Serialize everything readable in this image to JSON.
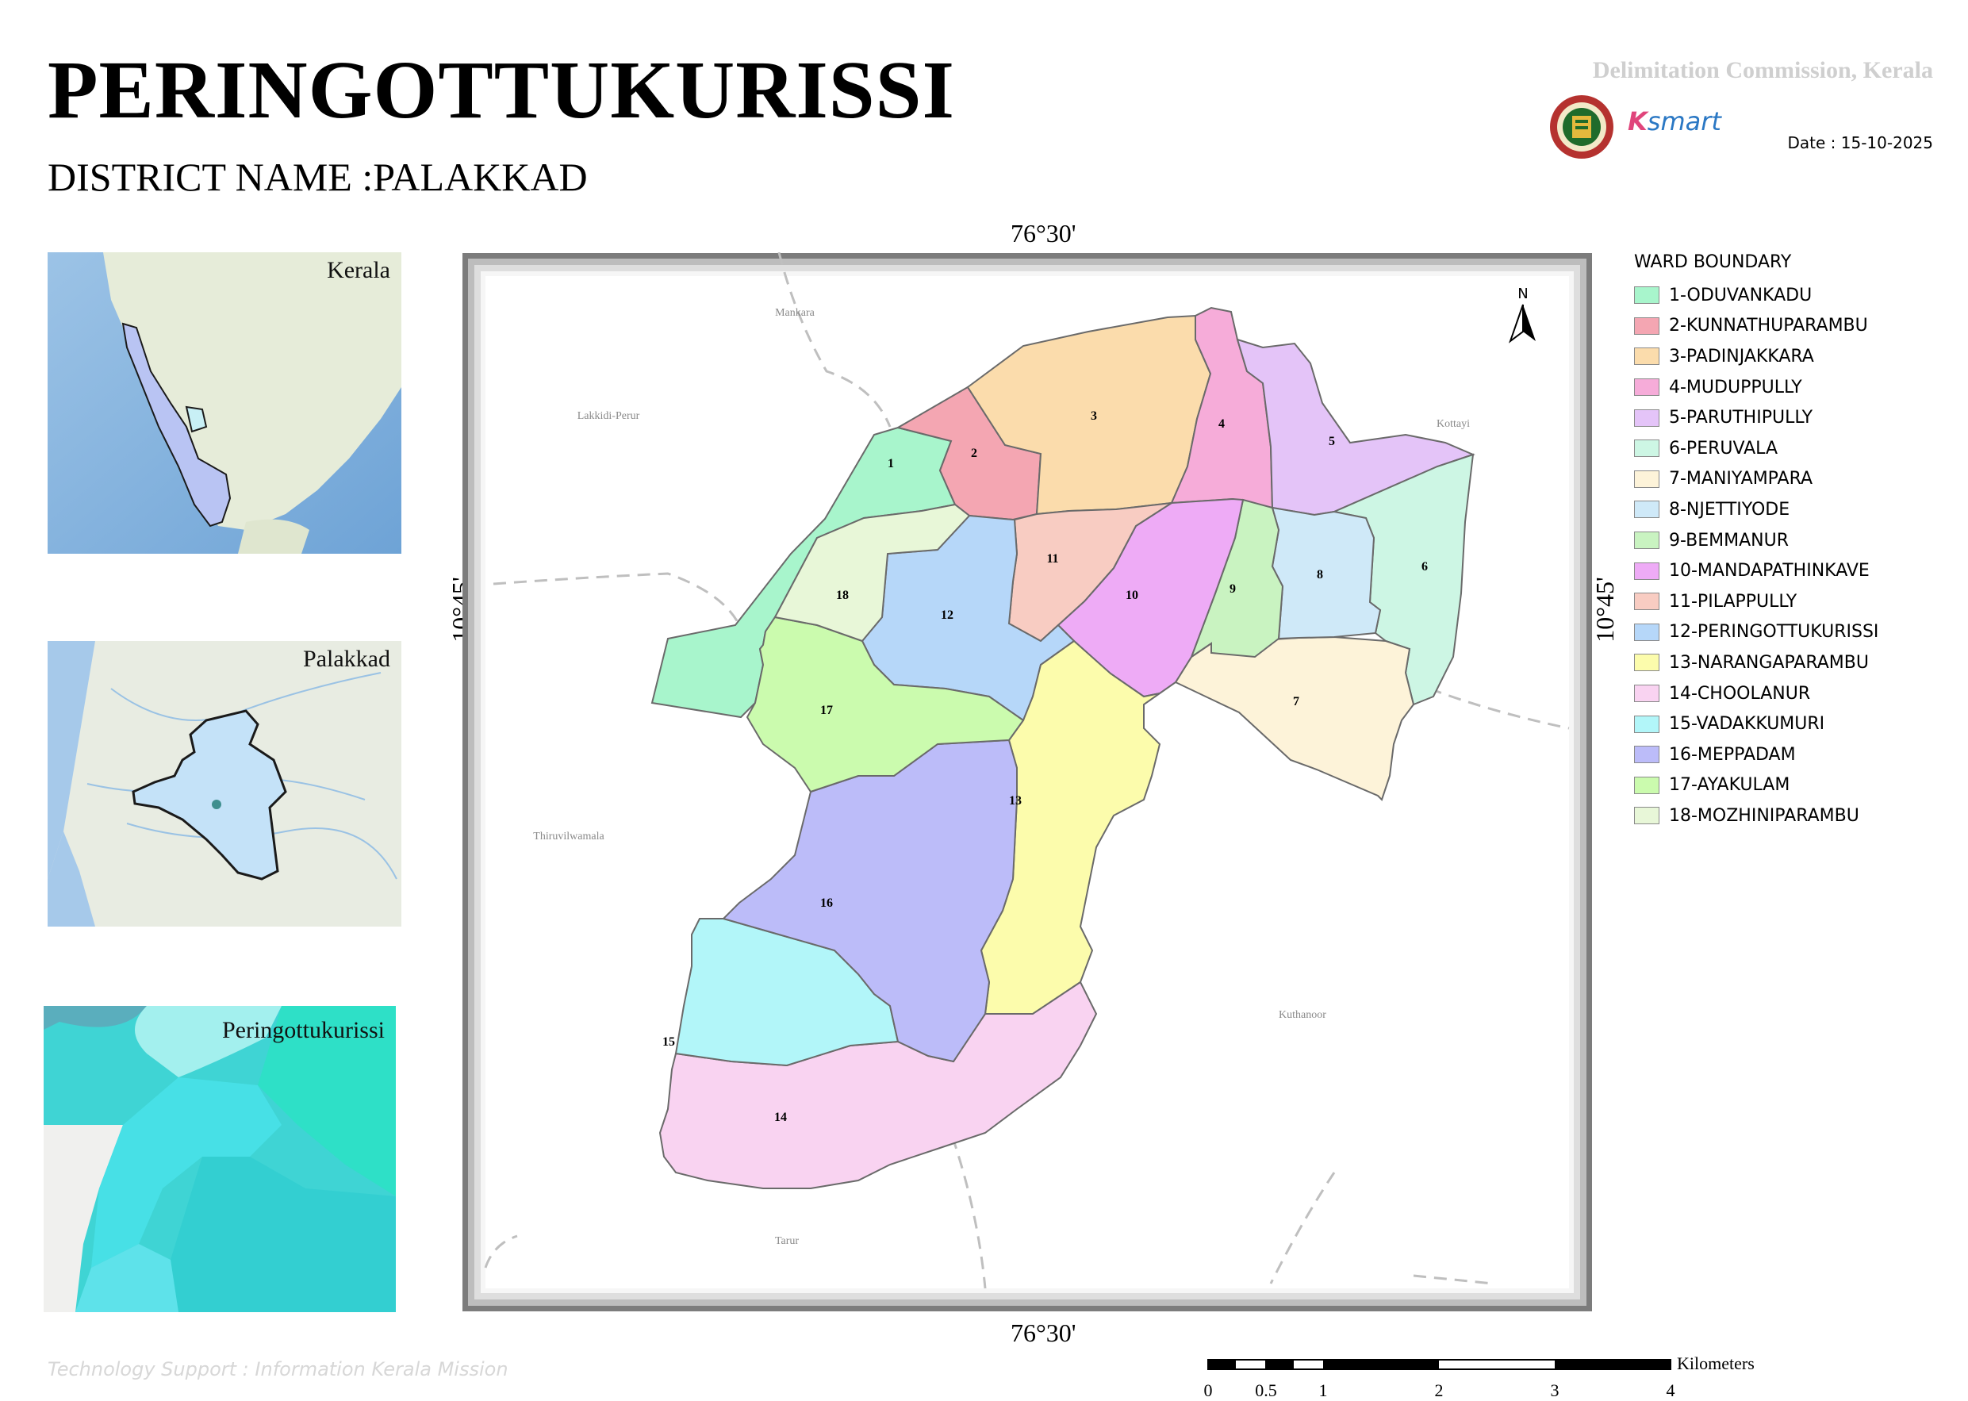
{
  "header": {
    "title": "PERINGOTTUKURISSI",
    "district": "DISTRICT NAME :PALAKKAD",
    "commission": "Delimitation Commission, Kerala",
    "date": "Date : 15-10-2025",
    "logo_text_k": "K",
    "logo_text_smart": "smart"
  },
  "insets": {
    "kerala": "Kerala",
    "palakkad": "Palakkad",
    "local": "Peringottukurissi"
  },
  "coordinates": {
    "top": "76°30'",
    "bottom": "76°30'",
    "left": "10°45'",
    "right": "10°45'"
  },
  "north_arrow": "N",
  "place_labels": {
    "mankara": "Mankara",
    "lakkidi": "Lakkidi-Perur",
    "kottayi": "Kottayi",
    "thiruvilwamala": "Thiruvilwamala",
    "kuthanoor": "Kuthanoor",
    "tarur": "Tarur"
  },
  "legend": {
    "title": "WARD BOUNDARY",
    "items": [
      {
        "label": "1-ODUVANKADU",
        "color": "#a8f5cc"
      },
      {
        "label": "2-KUNNATHUPARAMBU",
        "color": "#f4a6b2"
      },
      {
        "label": "3-PADINJAKKARA",
        "color": "#fbdcac"
      },
      {
        "label": "4-MUDUPPULLY",
        "color": "#f6acd9"
      },
      {
        "label": "5-PARUTHIPULLY",
        "color": "#e4c4f8"
      },
      {
        "label": "6-PERUVALA",
        "color": "#cdf6e4"
      },
      {
        "label": "7-MANIYAMPARA",
        "color": "#fdf3d9"
      },
      {
        "label": "8-NJETTIYODE",
        "color": "#cfe9f8"
      },
      {
        "label": "9-BEMMANUR",
        "color": "#c9f3c1"
      },
      {
        "label": "10-MANDAPATHINKAVE",
        "color": "#eeabf6"
      },
      {
        "label": "11-PILAPPULLY",
        "color": "#f8ccc2"
      },
      {
        "label": "12-PERINGOTTUKURISSI",
        "color": "#b6d7f9"
      },
      {
        "label": "13-NARANGAPARAMBU",
        "color": "#fcfcac"
      },
      {
        "label": "14-CHOOLANUR",
        "color": "#f9d3f1"
      },
      {
        "label": "15-VADAKKUMURI",
        "color": "#b2f6f9"
      },
      {
        "label": "16-MEPPADAM",
        "color": "#bcbcf9"
      },
      {
        "label": "17-AYAKULAM",
        "color": "#cbfbae"
      },
      {
        "label": "18-MOZHINIPARAMBU",
        "color": "#e8f7d8"
      }
    ]
  },
  "wards": [
    "1",
    "2",
    "3",
    "4",
    "5",
    "6",
    "7",
    "8",
    "9",
    "10",
    "11",
    "12",
    "13",
    "14",
    "15",
    "16",
    "17",
    "18"
  ],
  "scale": {
    "unit": "Kilometers",
    "labels": [
      "0",
      "0.5",
      "1",
      "2",
      "3",
      "4"
    ]
  },
  "footer": {
    "tech_support": "Technology Support : Information Kerala Mission"
  }
}
